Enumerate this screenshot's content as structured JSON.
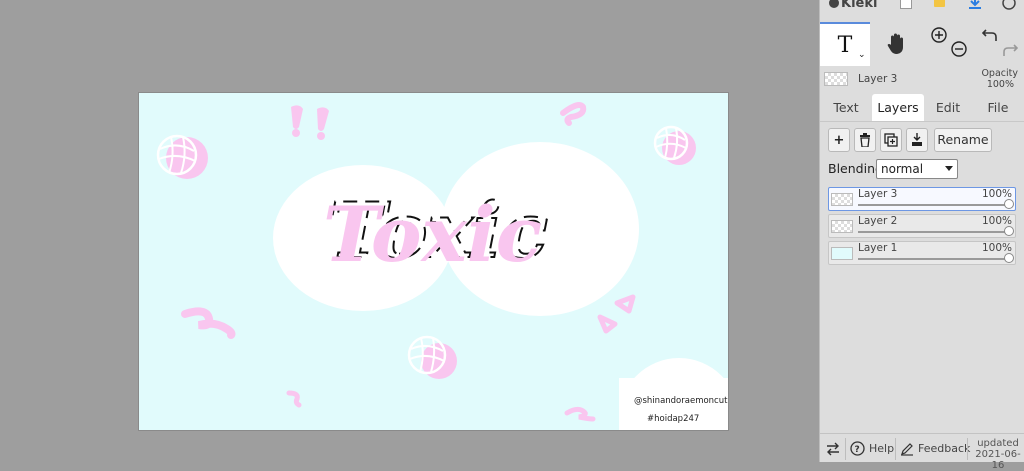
{
  "app": {
    "name": "Kleki"
  },
  "toolbar": {
    "tools": [
      {
        "name": "text-tool",
        "glyph": "T",
        "selected": true
      },
      {
        "name": "hand-tool",
        "selected": false
      }
    ]
  },
  "current_layer": {
    "name": "Layer 3",
    "opacity_label": "Opacity",
    "opacity_value": "100%"
  },
  "tabs": [
    {
      "label": "Text",
      "active": false
    },
    {
      "label": "Layers",
      "active": true
    },
    {
      "label": "Edit",
      "active": false
    },
    {
      "label": "File",
      "active": false
    }
  ],
  "layer_actions": {
    "add_glyph": "+",
    "rename_label": "Rename"
  },
  "blending": {
    "label": "Blending",
    "value": "normal"
  },
  "layers": [
    {
      "name": "Layer 3",
      "opacity": "100%",
      "level": 1.0,
      "active": true
    },
    {
      "name": "Layer 2",
      "opacity": "100%",
      "level": 1.0,
      "active": false
    },
    {
      "name": "Layer 1",
      "opacity": "100%",
      "level": 1.0,
      "active": false
    }
  ],
  "bottom": {
    "help_label": "Help",
    "feedback_label": "Feedback",
    "updated_label": "updated",
    "updated_date": "2021-06-16"
  },
  "artwork": {
    "title_text": "Toxic",
    "handle": "@shinandoraemoncute",
    "hashtag": "#hoidap247",
    "colors": {
      "background": "#e1fbfc",
      "accent_pink": "#f9c6ef",
      "white": "#ffffff"
    }
  },
  "colors": {
    "panel_bg": "#dddddd",
    "workspace_bg": "#9e9e9e",
    "selected_blue": "#6d97e4"
  }
}
